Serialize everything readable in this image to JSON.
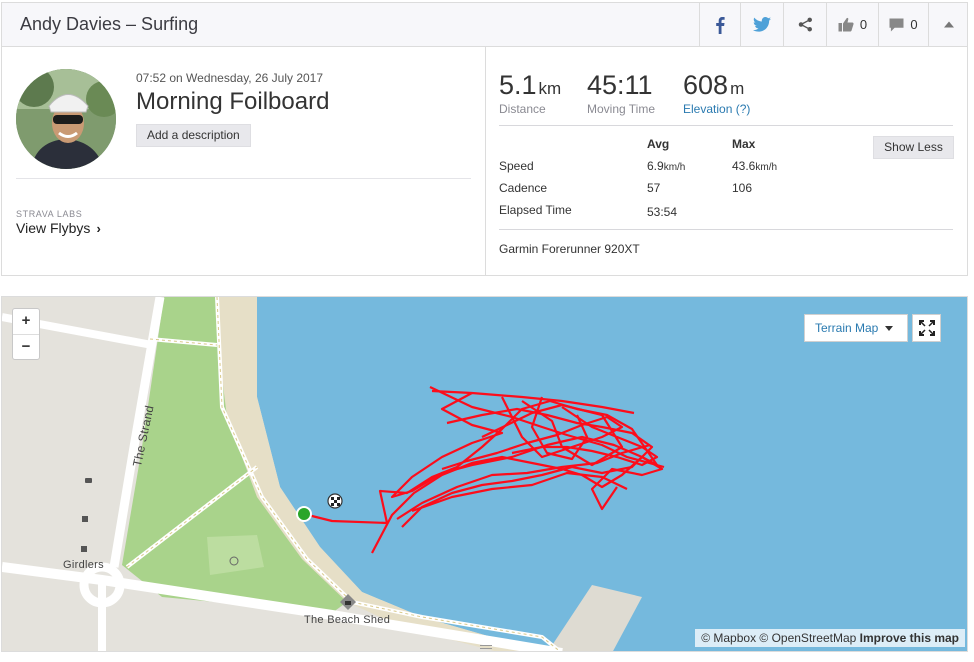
{
  "header": {
    "title": "Andy Davies – Surfing",
    "kudos_count": "0",
    "comment_count": "0",
    "icons": [
      "facebook-icon",
      "twitter-icon",
      "share-icon",
      "thumbs-up-icon",
      "comment-icon",
      "collapse-icon"
    ]
  },
  "activity": {
    "datetime": "07:52 on Wednesday, 26 July 2017",
    "name": "Morning Foilboard",
    "description_button": "Add a description",
    "labs_label": "STRAVA LABS",
    "flybys_link": "View Flybys"
  },
  "stats": {
    "distance": {
      "value": "5.1",
      "unit": "km",
      "label": "Distance"
    },
    "moving_time": {
      "value": "45:11",
      "label": "Moving Time"
    },
    "elevation": {
      "value": "608",
      "unit": "m",
      "label": "Elevation (?)"
    }
  },
  "details": {
    "headers": {
      "avg": "Avg",
      "max": "Max"
    },
    "rows": [
      {
        "label": "Speed",
        "avg": "6.9",
        "avg_unit": "km/h",
        "max": "43.6",
        "max_unit": "km/h"
      },
      {
        "label": "Cadence",
        "avg": "57",
        "max": "106"
      },
      {
        "label": "Elapsed Time",
        "avg": "53:54"
      }
    ],
    "show_less_button": "Show Less",
    "device": "Garmin Forerunner 920XT"
  },
  "map": {
    "zoom_in": "+",
    "zoom_out": "−",
    "layer_select": "Terrain Map",
    "labels": {
      "road": "The Strand",
      "poi_1": "Girdlers",
      "poi_2": "The Beach Shed"
    },
    "attribution_prefix": "© Mapbox © OpenStreetMap",
    "attribution_link": "Improve this map",
    "colors": {
      "water": "#75b9dd",
      "park": "#a9d38b",
      "beach": "#e6dfc7",
      "track": "#fc0d1b",
      "start": "#2aa52a"
    }
  }
}
